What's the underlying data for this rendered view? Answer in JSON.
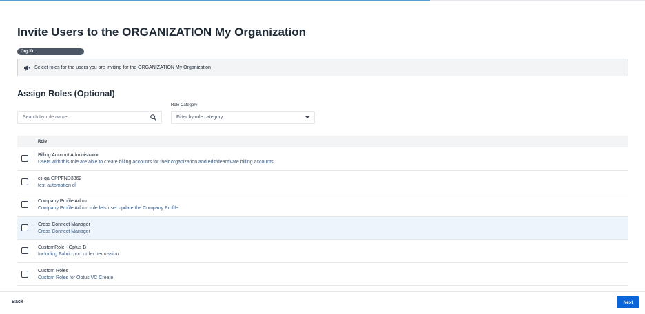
{
  "progress": {
    "fraction": 0.667,
    "color": "#5b9bd5"
  },
  "page_title": "Invite Users to the ORGANIZATION My Organization",
  "org_id": {
    "label": "Org ID:"
  },
  "banner": {
    "icon": "megaphone-icon",
    "text": "Select roles for the users you are inviting for the ORGANIZATION My Organization"
  },
  "section_title": "Assign Roles (Optional)",
  "search": {
    "placeholder": "Search by role name",
    "icon": "search-icon"
  },
  "role_category": {
    "label": "Role Category",
    "selected": "Filter by role category"
  },
  "table": {
    "header": "Role",
    "rows": [
      {
        "name": "Billing Account Administrator",
        "description": "Users with this role are able to create billing accounts for their organization and edit/deactivate billing accounts.",
        "highlighted": false
      },
      {
        "name": "cli-qa-CPPFND3362",
        "description": "test automation cli",
        "highlighted": false
      },
      {
        "name": "Company Profile Admin",
        "description": "Company Profile Admin role lets user update the Company Profile",
        "highlighted": false
      },
      {
        "name": "Cross Connect Manager",
        "description": "Cross Connect Manager",
        "highlighted": true
      },
      {
        "name": "CustomRole - Optus B",
        "description": "Including Fabric port order permission",
        "highlighted": false
      },
      {
        "name": "Custom Roles",
        "description": "Custom Roles for Optus VC Create",
        "highlighted": false
      }
    ]
  },
  "footer": {
    "back_label": "Back",
    "next_label": "Next",
    "next_color": "#0b64d8"
  }
}
